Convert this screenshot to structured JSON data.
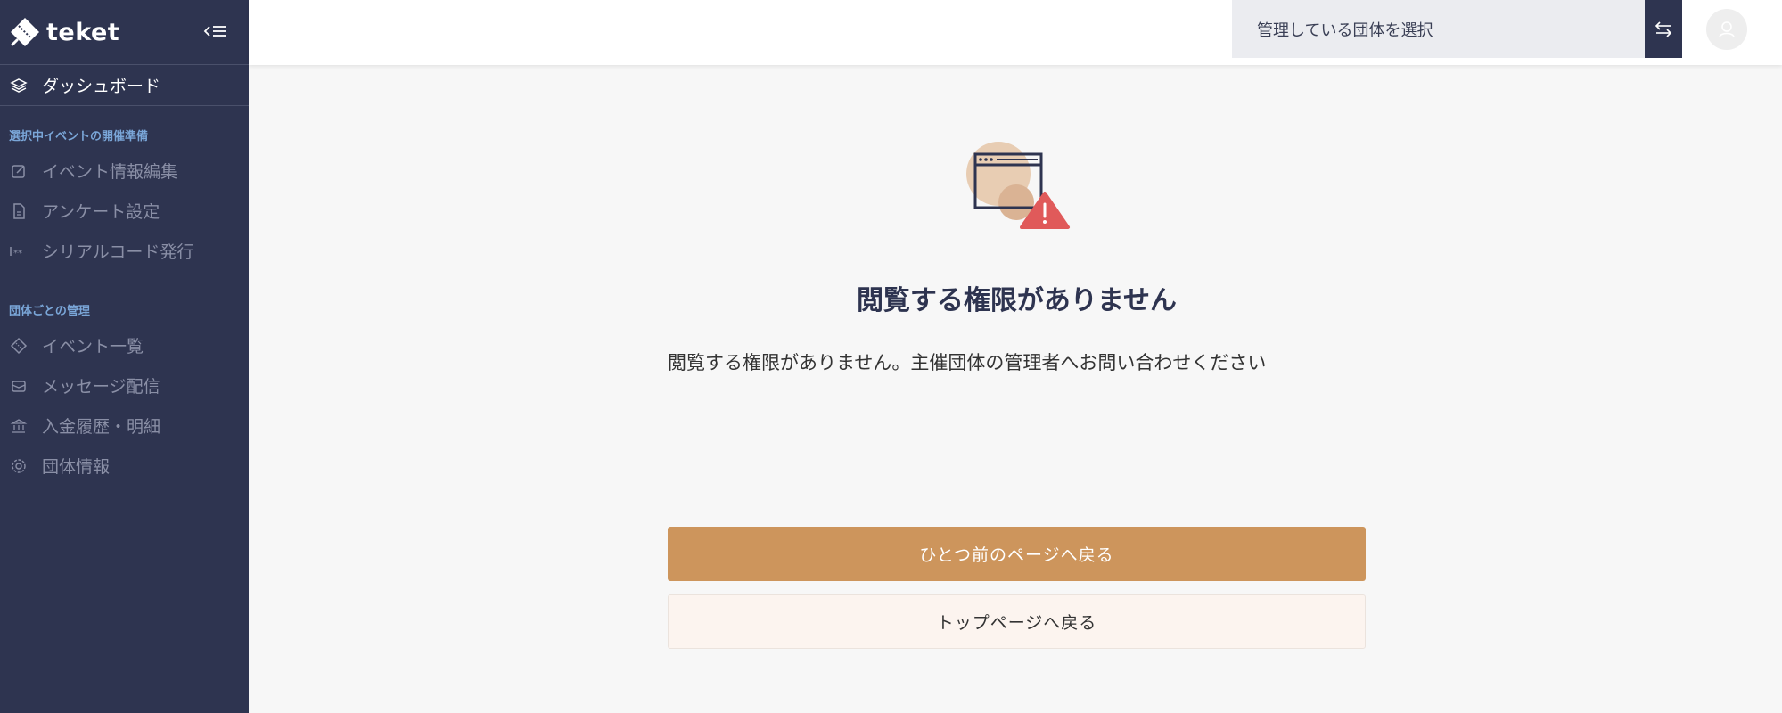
{
  "brand": {
    "name": "teket"
  },
  "sidebar": {
    "dashboard": {
      "label": "ダッシュボード",
      "icon": "layers-icon"
    },
    "section_event_prep": {
      "label": "選択中イベントの開催準備",
      "items": [
        {
          "label": "イベント情報編集",
          "icon": "edit-icon"
        },
        {
          "label": "アンケート設定",
          "icon": "document-icon"
        },
        {
          "label": "シリアルコード発行",
          "icon": "serial-code-icon"
        }
      ]
    },
    "section_org": {
      "label": "団体ごとの管理",
      "items": [
        {
          "label": "イベント一覧",
          "icon": "ticket-icon"
        },
        {
          "label": "メッセージ配信",
          "icon": "mail-icon"
        },
        {
          "label": "入金履歴・明細",
          "icon": "bank-icon"
        },
        {
          "label": "団体情報",
          "icon": "gear-icon"
        }
      ]
    }
  },
  "header": {
    "org_select_placeholder": "管理している団体を選択"
  },
  "main": {
    "title": "閲覧する権限がありません",
    "message": "閲覧する権限がありません。主催団体の管理者へお問い合わせください",
    "back_button": "ひとつ前のページへ戻る",
    "top_button": "トップページへ戻る"
  },
  "colors": {
    "sidebar_bg": "#2e3450",
    "section_label": "#7aa6d8",
    "primary_button": "#cd955c",
    "secondary_button_bg": "#fcf4ef",
    "warning": "#e05a5a"
  }
}
